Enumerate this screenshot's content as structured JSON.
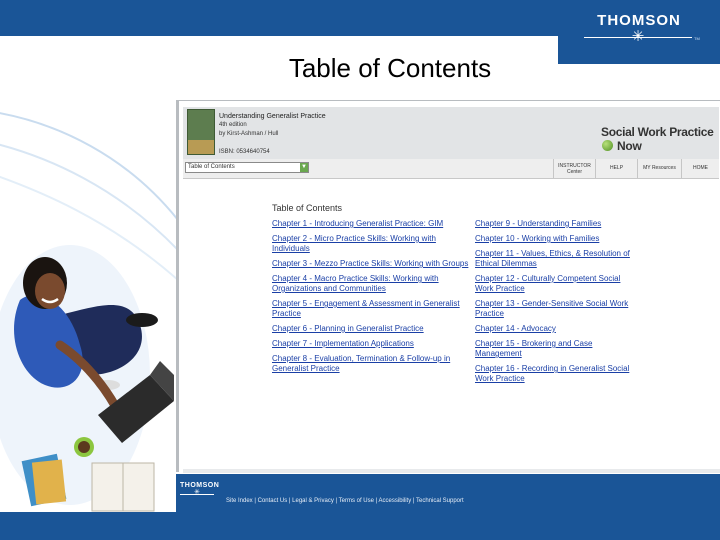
{
  "slide": {
    "title": "Table of Contents",
    "brand": "THOMSON",
    "brand_tm": "TM"
  },
  "colors": {
    "brand_blue": "#1a5597",
    "link_blue": "#1a3fa6",
    "accent_green": "#6aa84f"
  },
  "app": {
    "book_title": "Understanding Generalist Practice",
    "edition": "4th edition",
    "author": "by Kirst-Ashman / Hull",
    "isbn": "ISBN: 0534640754",
    "product_name_left": "Social Work Practice",
    "product_name_right": "Now",
    "select_value": "Table of Contents",
    "toolbar": {
      "instructor_line1": "INSTRUCTOR",
      "instructor_line2": "Center",
      "help": "HELP",
      "research": "MY Resources",
      "home": "HOME"
    },
    "toc": {
      "heading": "Table of Contents",
      "left": [
        "Chapter 1 - Introducing Generalist Practice: GIM",
        "Chapter 2 - Micro Practice Skills: Working with Individuals",
        "Chapter 3 - Mezzo Practice Skills: Working with Groups",
        "Chapter 4 - Macro Practice Skills: Working with Organizations and Communities",
        "Chapter 5 - Engagement & Assessment in Generalist Practice",
        "Chapter 6 - Planning in Generalist Practice",
        "Chapter 7 - Implementation Applications",
        "Chapter 8 - Evaluation, Termination & Follow-up in Generalist Practice"
      ],
      "right": [
        "Chapter 9 - Understanding Families",
        "Chapter 10 - Working with Families",
        "Chapter 11 - Values, Ethics, & Resolution of Ethical Dilemmas",
        "Chapter 12 - Culturally Competent Social Work Practice",
        "Chapter 13 - Gender-Sensitive Social Work Practice",
        "Chapter 14 - Advocacy",
        "Chapter 15 - Brokering and Case Management",
        "Chapter 16 - Recording in Generalist Social Work Practice"
      ]
    }
  },
  "footer": {
    "logo": "THOMSON",
    "links": "Site Index | Contact Us | Legal & Privacy | Terms of Use | Accessibility | Technical Support"
  }
}
